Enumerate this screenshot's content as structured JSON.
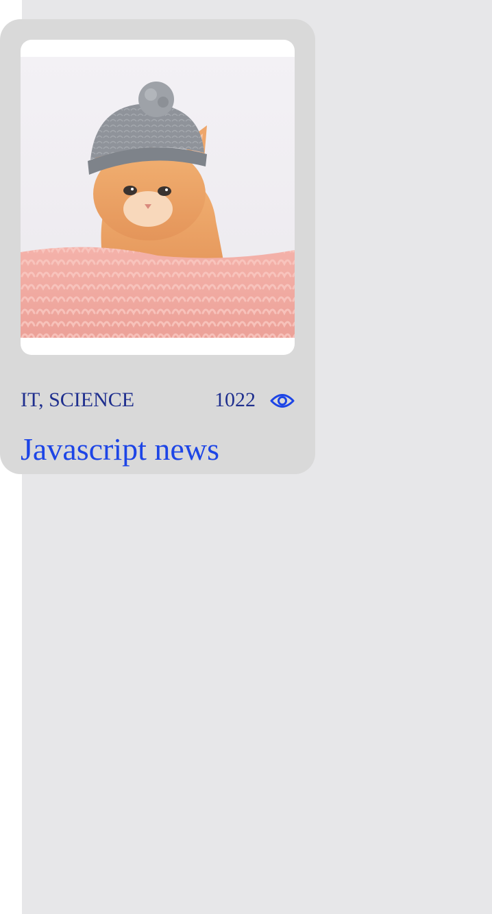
{
  "card": {
    "category": "IT, SCIENCE",
    "views": "1022",
    "title": "Javascript news",
    "image_alt": "kitten in knitted hat",
    "icons": {
      "views": "eye-icon"
    }
  },
  "colors": {
    "card_bg": "#d9d9d9",
    "page_bg": "#e7e7e9",
    "meta_text": "#1f2f8e",
    "title_text": "#1d45e6",
    "icon": "#1d45e6"
  }
}
